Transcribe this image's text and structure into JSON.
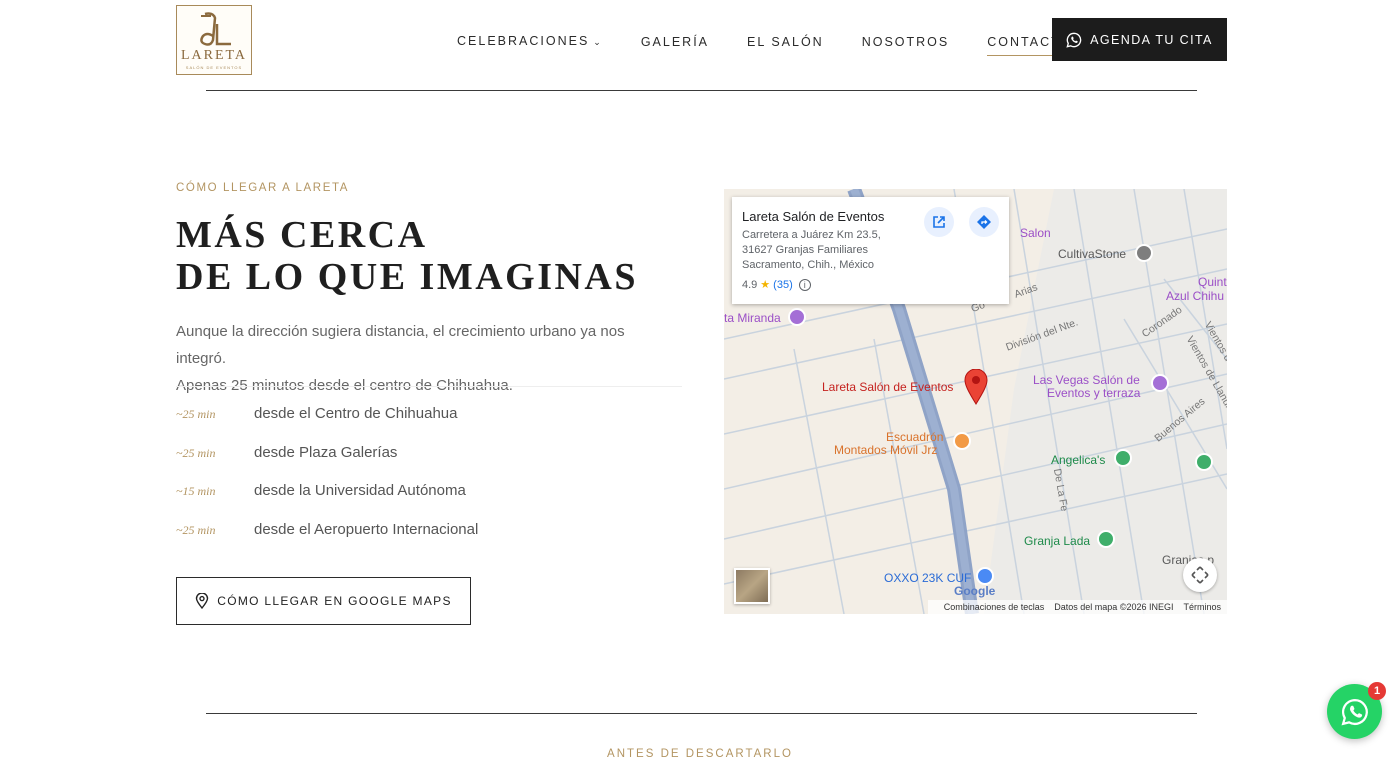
{
  "brand": {
    "logo_text": "LARETA",
    "logo_sub": "SALÓN DE EVENTOS"
  },
  "nav": {
    "items": [
      {
        "label": "CELEBRACIONES",
        "has_dropdown": true
      },
      {
        "label": "GALERÍA"
      },
      {
        "label": "EL SALÓN"
      },
      {
        "label": "NOSOTROS"
      },
      {
        "label": "CONTACTO",
        "active": true
      }
    ],
    "cta_label": "AGENDA TU CITA"
  },
  "section": {
    "eyebrow": "CÓMO LLEGAR A LARETA",
    "headline_line1": "MÁS CERCA",
    "headline_line2": "DE LO QUE IMAGINAS",
    "intro_line1": "Aunque la dirección sugiera distancia, el crecimiento urbano ya nos integró.",
    "intro_line2": "Apenas 25 minutos desde el centro de Chihuahua.",
    "times": [
      {
        "value": "~25 min",
        "desc": "desde el Centro de Chihuahua"
      },
      {
        "value": "~25 min",
        "desc": "desde Plaza Galerías"
      },
      {
        "value": "~15 min",
        "desc": "desde la Universidad Autónoma"
      },
      {
        "value": "~25 min",
        "desc": "desde el Aeropuerto Internacional"
      }
    ],
    "maps_button": "CÓMO LLEGAR EN GOOGLE MAPS"
  },
  "map": {
    "info": {
      "title": "Lareta Salón de Eventos",
      "addr1": "Carretera a Juárez Km 23.5,",
      "addr2": "31627 Granjas Familiares",
      "addr3": "Sacramento, Chih., México",
      "rating": "4.9",
      "reviews": "(35)"
    },
    "labels": {
      "salon": "Salon",
      "cultivastone": "CultivaStone",
      "quinta": "Quinta",
      "azul": "Azul Chihu",
      "miranda": "ta Miranda",
      "pin": "Lareta Salón de Eventos",
      "vegas1": "Las Vegas Salón de",
      "vegas2": "Eventos y terraza",
      "escuadron1": "Escuadrón",
      "escuadron2": "Montados Móvil Jrz",
      "angelicas": "Angelica's",
      "granja": "Granja Lada",
      "oxxo": "OXXO 23K CUF",
      "granjas": "Granjas p",
      "st_division": "División del Nte.",
      "st_coronado": "Coronado",
      "st_vientos1": "Vientos del",
      "st_vientos2": "Vientos de Llanura",
      "st_buenos": "Buenos Aires",
      "st_delafe": "De La Fe",
      "st_arias": "Arias",
      "st_go": "Go",
      "google": "Google"
    },
    "footer": {
      "shortcuts": "Combinaciones de teclas",
      "data": "Datos del mapa ©2026 INEGI",
      "terms": "Términos"
    }
  },
  "next_section": {
    "eyebrow": "ANTES DE DESCARTARLO"
  },
  "whatsapp": {
    "badge": "1"
  },
  "colors": {
    "accent_gold": "#b39562",
    "dark": "#1c1c1c",
    "whatsapp_green": "#25d366"
  }
}
